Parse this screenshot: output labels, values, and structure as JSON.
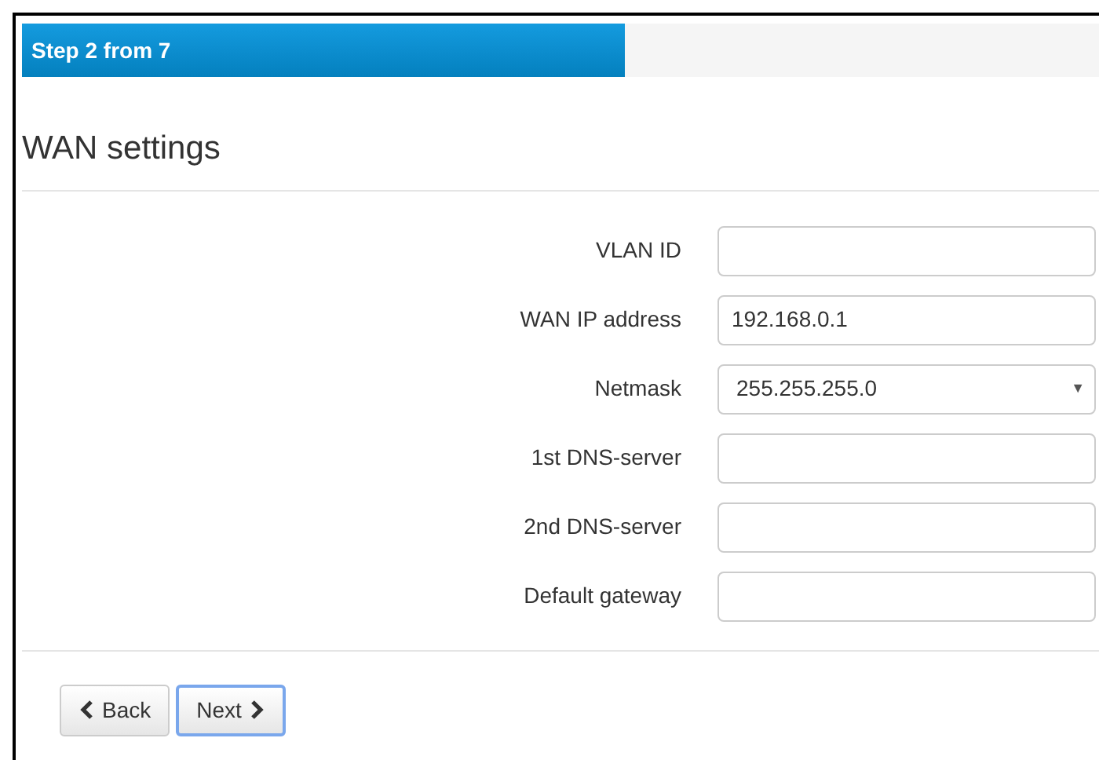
{
  "progress": {
    "label": "Step 2 from 7",
    "level": 0.56
  },
  "title": "WAN settings",
  "fields": [
    {
      "kind": "text",
      "label": "VLAN ID"
    },
    {
      "kind": "text",
      "label": "WAN IP address",
      "value": "192.168.0.1"
    },
    {
      "kind": "select",
      "label": "Netmask",
      "value": "255.255.255.0",
      "arrow": "▼"
    },
    {
      "kind": "text",
      "label": "1st DNS-server"
    },
    {
      "kind": "text",
      "label": "2nd DNS-server"
    },
    {
      "kind": "text",
      "label": "Default gateway"
    }
  ],
  "buttons": [
    {
      "kind": "back",
      "label": "Back",
      "focused": false
    },
    {
      "kind": "next",
      "label": "Next",
      "focused": true
    }
  ]
}
